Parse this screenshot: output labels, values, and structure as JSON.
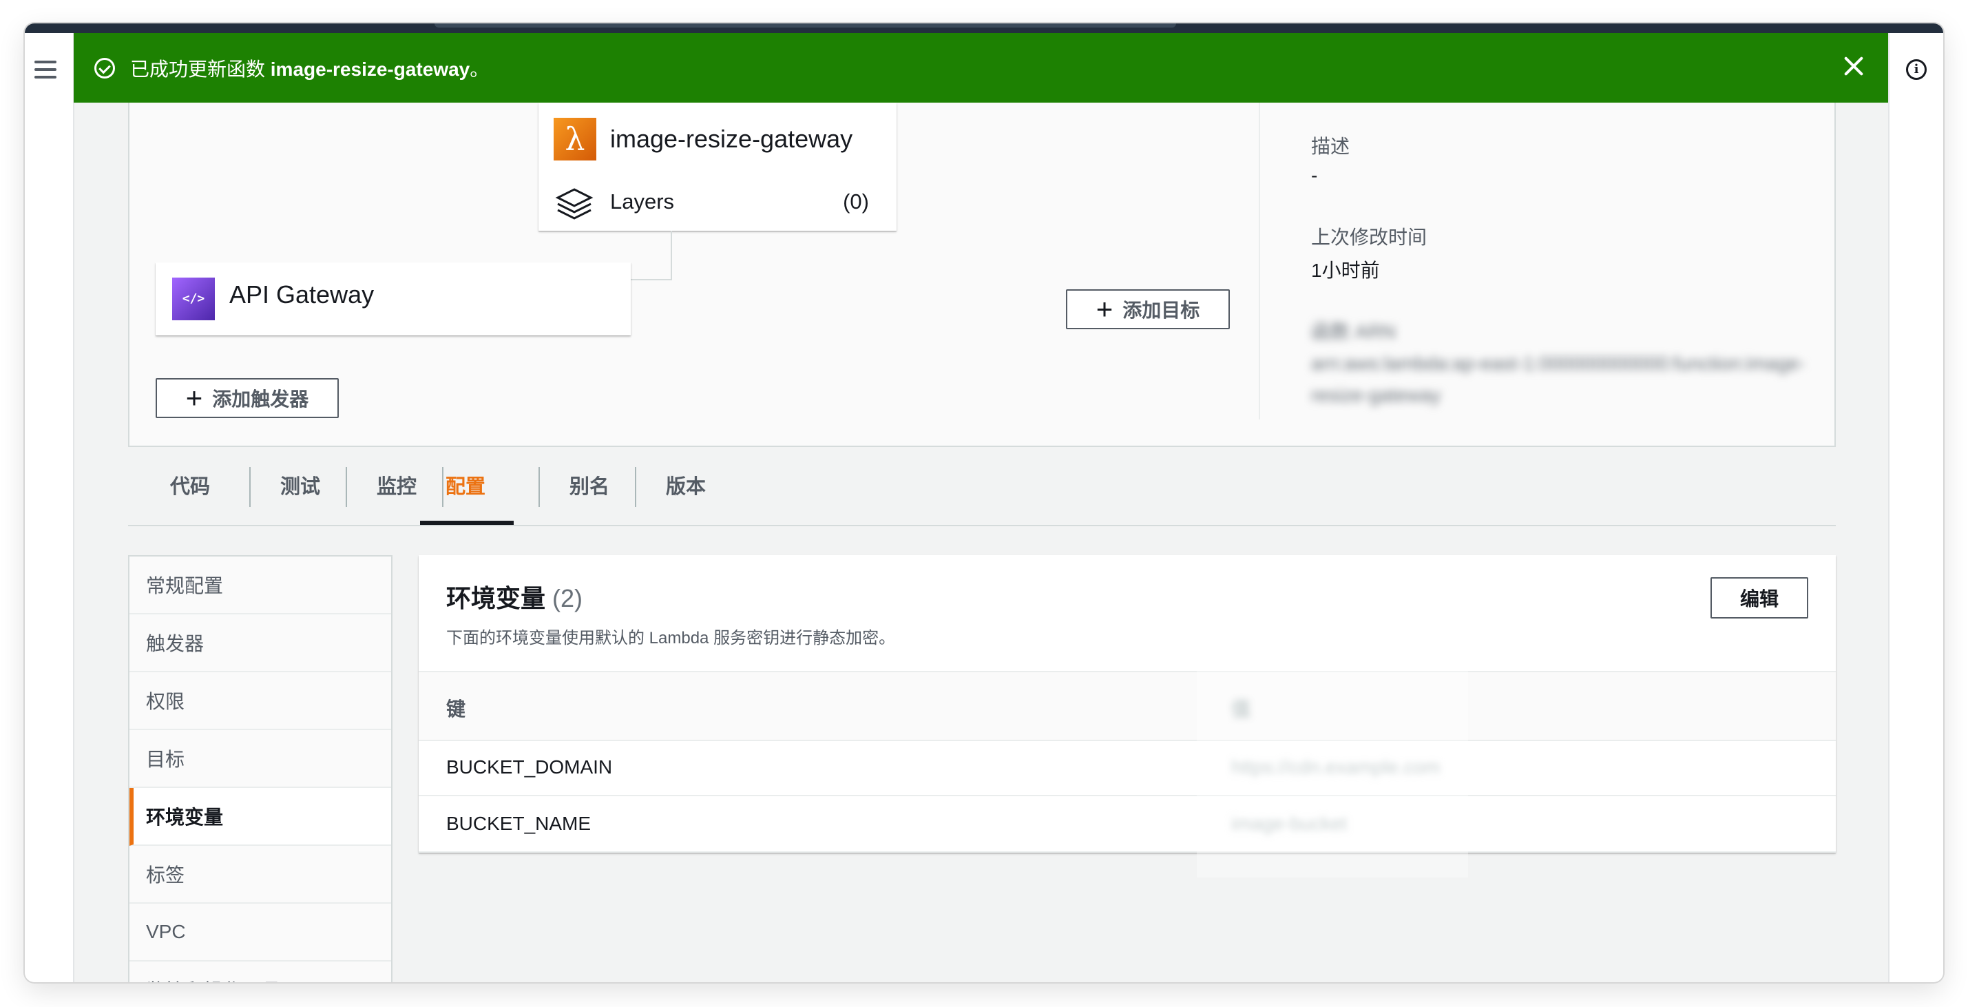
{
  "banner": {
    "prefix": "已成功更新函数 ",
    "function_name": "image-resize-gateway",
    "suffix": "。"
  },
  "diagram": {
    "function_name": "image-resize-gateway",
    "layers_label": "Layers",
    "layers_count": "(0)",
    "trigger_name": "API Gateway",
    "add_trigger_label": "添加触发器",
    "add_target_label": "添加目标"
  },
  "details": {
    "description_label": "描述",
    "description_value": "-",
    "last_modified_label": "上次修改时间",
    "last_modified_value": "1小时前",
    "arn_label": "函数 ARN",
    "arn_value_line1": "arn:aws:lambda:ap-east-1:000000000000:function:image-resize-gateway"
  },
  "tabs": [
    "代码",
    "测试",
    "监控",
    "配置",
    "别名",
    "版本"
  ],
  "active_tab": "配置",
  "sidenav": [
    "常规配置",
    "触发器",
    "权限",
    "目标",
    "环境变量",
    "标签",
    "VPC",
    "监控和操作工具"
  ],
  "active_sidenav": "环境变量",
  "env": {
    "title": "环境变量",
    "count": "(2)",
    "description": "下面的环境变量使用默认的 Lambda 服务密钥进行静态加密。",
    "edit_label": "编辑",
    "col_key": "键",
    "col_value": "值",
    "rows": [
      {
        "key": "BUCKET_DOMAIN",
        "value": "https://cdn.example.com"
      },
      {
        "key": "BUCKET_NAME",
        "value": "image-bucket"
      }
    ]
  },
  "colors": {
    "success": "#1d8102",
    "accent": "#ec7211",
    "lambda_icon": "#d45b07",
    "apigw_icon": "#4d27aa"
  }
}
